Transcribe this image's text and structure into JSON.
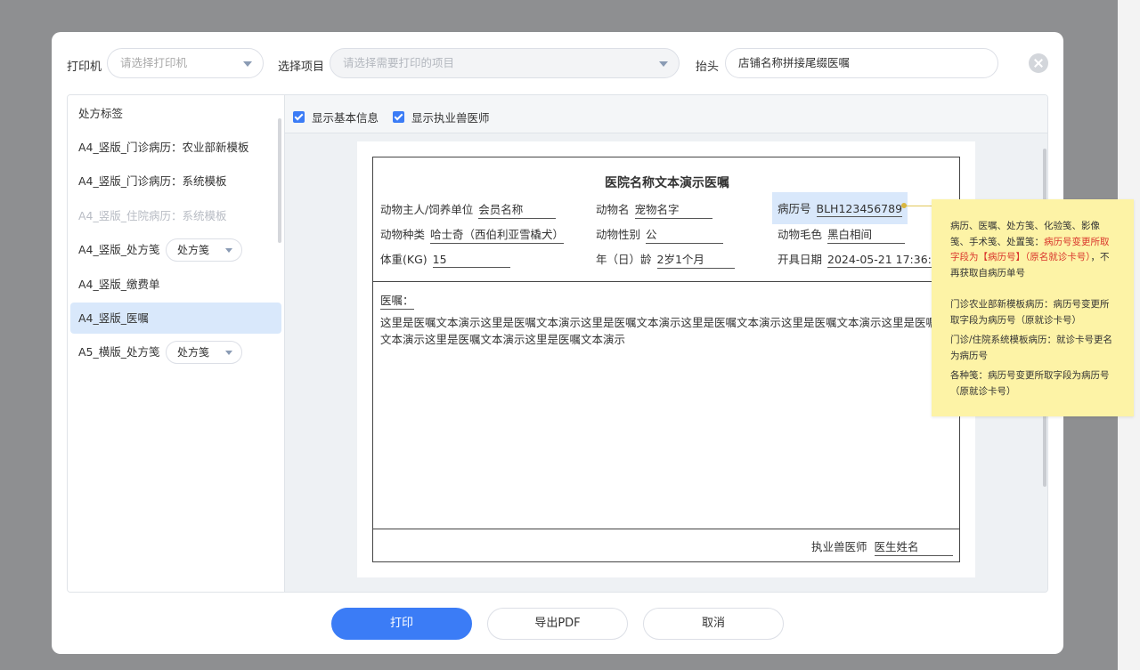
{
  "toolbar": {
    "printer_label": "打印机",
    "printer_placeholder": "请选择打印机",
    "project_label": "选择项目",
    "project_placeholder": "请选择需要打印的项目",
    "header_label": "抬头",
    "header_value": "店铺名称拼接尾缀医嘱"
  },
  "sidebar": {
    "items": [
      {
        "label": "处方标签"
      },
      {
        "label": "A4_竖版_门诊病历：农业部新模板"
      },
      {
        "label": "A4_竖版_门诊病历：系统模板"
      },
      {
        "label": "A4_竖版_住院病历：系统模板",
        "disabled": true
      },
      {
        "label": "A4_竖版_处方笺",
        "select": "处方笺"
      },
      {
        "label": "A4_竖版_缴费单"
      },
      {
        "label": "A4_竖版_医嘱",
        "active": true
      },
      {
        "label": "A5_横版_处方笺",
        "select": "处方笺"
      }
    ]
  },
  "options": {
    "show_basic_info": "显示基本信息",
    "show_vet": "显示执业兽医师"
  },
  "document": {
    "title": "医院名称文本演示医嘱",
    "owner_label": "动物主人/饲养单位",
    "owner_value": "会员名称",
    "pet_name_label": "动物名",
    "pet_name_value": "宠物名字",
    "record_no_label": "病历号",
    "record_no_value": "BLH123456789",
    "species_label": "动物种类",
    "species_value": "哈士奇（西伯利亚雪橇犬）",
    "sex_label": "动物性别",
    "sex_value": "公",
    "color_label": "动物毛色",
    "color_value": "黑白相间",
    "weight_label": "体重(KG)",
    "weight_value": "15",
    "age_label": "年（日）龄",
    "age_value": "2岁1个月",
    "date_label": "开具日期",
    "date_value": "2024-05-21 17:36:17",
    "advice_label": "医嘱：",
    "advice_text": "这里是医嘱文本演示这里是医嘱文本演示这里是医嘱文本演示这里是医嘱文本演示这里是医嘱文本演示这里是医嘱文本演示这里是医嘱文本演示这里是医嘱文本演示",
    "vet_label": "执业兽医师",
    "vet_value": "医生姓名"
  },
  "note": {
    "p1_prefix": "病历、医嘱、处方笺、化验笺、影像笺、手术笺、处置笺：",
    "p1_red": "病历号变更所取字段为【病历号】（原名就诊卡号）",
    "p1_suffix": "，不再获取自病历单号",
    "p2": "门诊农业部新模板病历：病历号变更所取字段为病历号（原就诊卡号）",
    "p3": "门诊/住院系统模板病历：就诊卡号更名为病历号",
    "p4": "各种笺：病历号变更所取字段为病历号（原就诊卡号）"
  },
  "footer": {
    "print": "打印",
    "export_pdf": "导出PDF",
    "cancel": "取消"
  },
  "colors": {
    "primary": "#3b7cf6",
    "note_bg": "#fdf3a6",
    "highlight": "#d9e8fb",
    "note_red": "#d9342b"
  }
}
